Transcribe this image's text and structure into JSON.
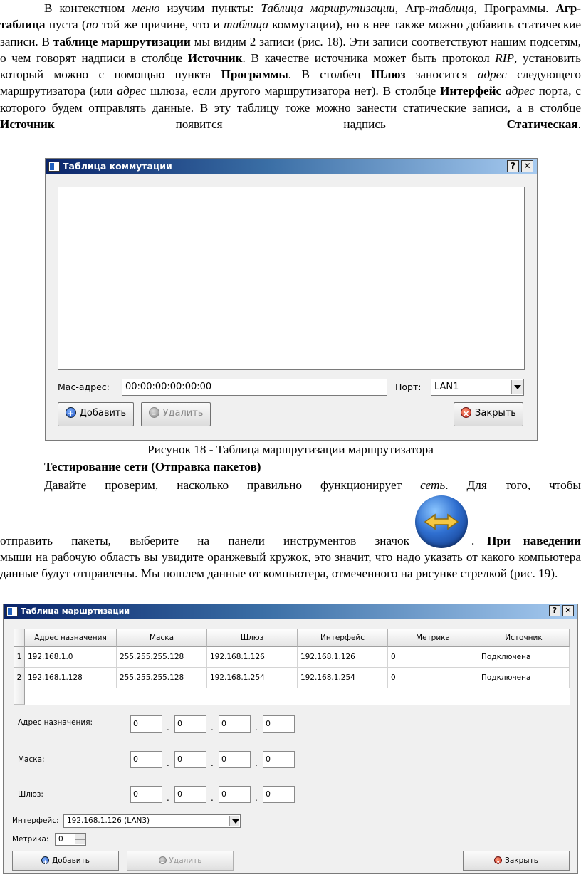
{
  "para1": {
    "t1": "В контекстном ",
    "t2": "меню",
    "t3": " изучим пункты: ",
    "t4": "Таблица маршрутизации",
    "t5": ", Агр-",
    "t6": "таблица",
    "t7": ", Программы. ",
    "t8": "Агр-таблица",
    "t9": " пуста (",
    "t10": "по",
    "t11": " той же причине, что и ",
    "t12": "таблица",
    "t13": " коммутации), но в нее также можно добавить статические записи. В ",
    "t14": "таблице маршрутизации",
    "t15": " мы видим 2 записи (рис. 18). Эти записи соответствуют нашим подсетям, о чем говорят надписи в столбце ",
    "t16": "Источник",
    "t17": ". В качестве источника может быть протокол ",
    "t18": "RIP",
    "t19": ", установить который можно с помощью пункта ",
    "t20": "Программы",
    "t21": ". В столбец ",
    "t22": "Шлюз",
    "t23": " заносится ",
    "t24": "адрес",
    "t25": " следующего маршрутизатора (или ",
    "t26": "адрес",
    "t27": " шлюза, если другого маршрутизатора нет). В столбце ",
    "t28": "Интерфейс",
    "t29": " ",
    "t30": "адрес",
    "t31": " порта, с которого будем отправлять данные. В эту таблицу тоже можно занести статические записи, а в столбце ",
    "t32": "Источник",
    "t33": " появится надпись ",
    "t34": "Статическая",
    "t35": "."
  },
  "dialog1": {
    "title": "Таблица коммутации",
    "help": "?",
    "close": "✕",
    "mac_label": "Mac-адрес:",
    "mac_value": "00:00:00:00:00:00",
    "port_label": "Порт:",
    "port_value": "LAN1",
    "add": "Добавить",
    "delete": "Удалить",
    "close_btn": "Закрыть"
  },
  "caption": "Рисунок 18 - Таблица маршрутизации маршрутизатора",
  "heading": "Тестирование сети (Отправка пакетов)",
  "para2": {
    "t1": "Давайте проверим, насколько правильно функционирует ",
    "t2": "сеть",
    "t3": ". Для того, чтобы",
    "t4": "отправить пакеты, выберите на панели инструментов значок",
    "t5": ". ",
    "t6": "При наведении",
    "t7": " мыши на рабочую область вы увидите оранжевый кружок, это значит, что надо указать от какого компьютера данные будут отправлены. Мы пошлем данные от компьютера, отмеченного на рисунке стрелкой (рис. 19)."
  },
  "dialog2": {
    "title": "Таблица маршртизации",
    "help": "?",
    "close": "✕",
    "headers": [
      "Адрес назначения",
      "Маска",
      "Шлюз",
      "Интерфейс",
      "Метрика",
      "Источник"
    ],
    "rows": [
      {
        "num": "1",
        "cells": [
          "192.168.1.0",
          "255.255.255.128",
          "192.168.1.126",
          "192.168.1.126",
          "0",
          "Подключена"
        ]
      },
      {
        "num": "2",
        "cells": [
          "192.168.1.128",
          "255.255.255.128",
          "192.168.1.254",
          "192.168.1.254",
          "0",
          "Подключена"
        ]
      }
    ],
    "dest_label": "Адрес назначения:",
    "mask_label": "Маска:",
    "gw_label": "Шлюз:",
    "octet": "0",
    "dot": ".",
    "iface_label": "Интерфейс:",
    "iface_value": "192.168.1.126 (LAN3)",
    "metric_label": "Метрика:",
    "metric_value": "0",
    "add": "Добавить",
    "delete": "Удалить",
    "close_btn": "Закрыть"
  },
  "icons": {
    "network_send": "blue-globe-arrows-icon"
  }
}
